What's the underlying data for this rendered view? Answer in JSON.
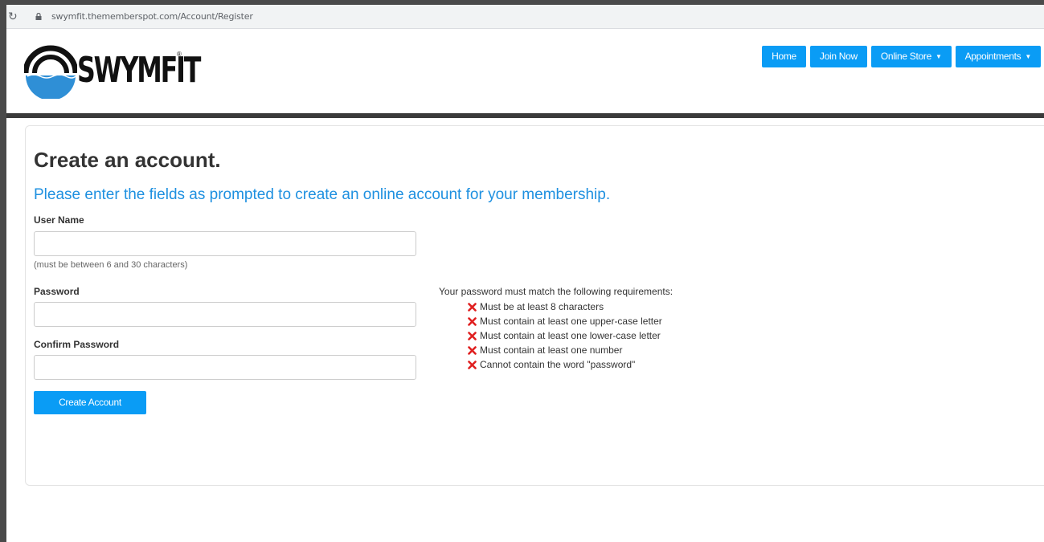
{
  "browser": {
    "url": "swymfit.thememberspot.com/Account/Register"
  },
  "icons": {
    "reload": "reload-icon",
    "lock": "lock-icon",
    "requirement_fail": "x-icon"
  },
  "colors": {
    "accent": "#0a9cf5",
    "subtitle": "#1e90e0",
    "error": "#e02020",
    "logo_blue": "#2f8fd6"
  },
  "header": {
    "logo_text": "SWYMFIT",
    "nav": [
      {
        "label": "Home"
      },
      {
        "label": "Join Now"
      },
      {
        "label": "Online Store"
      },
      {
        "label": "Appointments"
      }
    ]
  },
  "form": {
    "title": "Create an account.",
    "subtitle": "Please enter the fields as prompted to create an online account for your membership.",
    "username_label": "User Name",
    "username_value": "",
    "username_hint": "(must be between 6 and 30 characters)",
    "password_label": "Password",
    "password_value": "",
    "confirm_label": "Confirm Password",
    "confirm_value": "",
    "submit_label": "Create Account"
  },
  "requirements": {
    "title": "Your password must match the following requirements:",
    "items": [
      "Must be at least 8 characters",
      "Must contain at least one upper-case letter",
      "Must contain at least one lower-case letter",
      "Must contain at least one number",
      "Cannot contain the word \"password\""
    ]
  }
}
